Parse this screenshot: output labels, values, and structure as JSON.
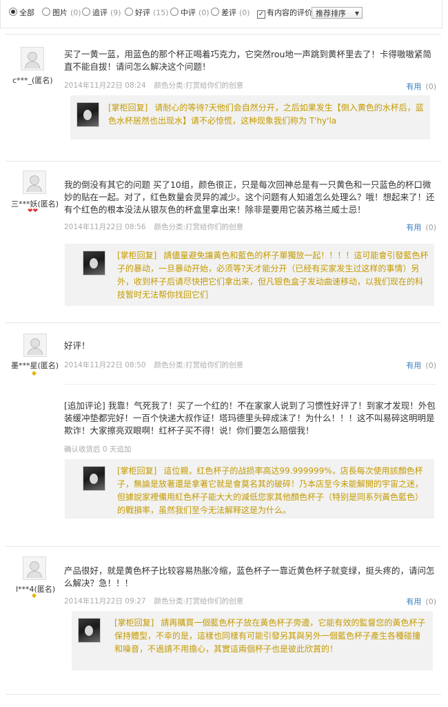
{
  "filter": {
    "options": [
      {
        "label": "全部",
        "count": "",
        "selected": true
      },
      {
        "label": "图片",
        "count": "(0)",
        "selected": false
      },
      {
        "label": "追评",
        "count": "(9)",
        "selected": false
      },
      {
        "label": "好评",
        "count": "(15)",
        "selected": false
      },
      {
        "label": "中评",
        "count": "(0)",
        "selected": false
      },
      {
        "label": "差评",
        "count": "(0)",
        "selected": false
      }
    ],
    "has_content_label": "有内容的评价",
    "has_content_checked": true,
    "sort_label": "推荐排序"
  },
  "reviews": [
    {
      "user": "c***_(匿名)",
      "content": "买了一黄一蓝，用蓝色的那个杯正喝着巧克力，它突然rou地一声跳到黄杯里去了！卡得嗷嗷紧简直不能自拔！请问怎么解决这个问题！",
      "date": "2014年11月22日 08:24",
      "attribute": "颜色分类:打赏给你们的创意",
      "useful_label": "有用",
      "useful_count": "(0)",
      "reply_tag": "[掌柜回复]",
      "reply": "请耐心的等待?天他们会自然分开，之后如果发生【倒入黄色的水杯后，蓝色水杯居然也出现水】请不必惊慌，这种现象我们称为 T'hy'la"
    },
    {
      "user": "三***妖(匿名)",
      "content": "我的倒没有其它的问题 买了10组，颜色很正，只是每次回神总是有一只黄色和一只蓝色的杯口微妙的贴在一起。对了，红色数量会灵异的减少。这个问题有人知道怎么处理么？哦！想起来了！还有个红色的根本没法从银灰色的杯盒里拿出来！除非是要用它装苏格兰威士忌！",
      "date": "2014年11月22日 08:56",
      "attribute": "颜色分类:打赏给你们的创意",
      "useful_label": "有用",
      "useful_count": "(0)",
      "reply_tag": "[掌柜回复]",
      "reply": "請儘量避免讓黃色和藍色的杯子單獨放一起！！！！這可能會引發藍色杯子的暴动，一旦暴动开始，必须等?天才能分开（已经有买家发生过这样的事情）另外，收到杯子后请尽快把它们拿出来，但凡银色盒子发动曲速移动，以我们现在的科技暂时无法帮你找回它们"
    },
    {
      "user": "墨***星(匿名)",
      "content": "好评！",
      "date": "2014年11月22日 08:50",
      "attribute": "颜色分类:打赏给你们的创意",
      "useful_label": "有用",
      "useful_count": "(0)",
      "append": "[追加评论] 我靠！气死我了！买了一个红的！不在家家人说到了习惯性好评了！到家才发现！外包装缓冲垫都完好！一百个快递大叔作证！塔玛德里头碎成沫了！为什么！！！这不叫易碎这明明是欺诈！大家擦亮双眼啊！红杯子买不得！说！你们要怎么赔偿我！",
      "append_meta": "确认收货后 0 天追加",
      "reply_tag": "[掌柜回复]",
      "reply": "這位親，红色杯子的战损率高达99.999999%，店長每次使用該顏色杯子，無論是放著還是拿著它就是會莫名其的破碎！乃本店至今未能解開的宇宙之迷，但據說家裡備用紅色杯子能大大的減低您家其他顏色杯子（特别是同系列黃色藍色）的戰損率，虽然我们至今无法解释这是为什么。"
    },
    {
      "user": "l***4(匿名)",
      "content": "产品很好，就是黄色杯子比较容易热胀冷缩，蓝色杯子一靠近黄色杯子就变绿，挺头疼的，请问怎么解决？急！！！",
      "date": "2014年11月22日 09:27",
      "attribute": "颜色分类:打赏给你们的创意",
      "useful_label": "有用",
      "useful_count": "(0)",
      "reply_tag": "[掌柜回复]",
      "reply": "請再購買一個藍色杯子放在黃色杯子旁邊，它能有效的監督您的黃色杯子保持體型，不幸的是，這樣也同樣有可能引發另其與另外一個藍色杯子產生各種碰撞和噪音，不過請不用擔心，其實這兩個杯子也是彼此欣賞的！"
    }
  ],
  "colors": {
    "accent_link": "#3a7fbe",
    "reply_text": "#c49a00",
    "reply_bg": "#f2f2f2",
    "muted": "#aaaaaa"
  }
}
